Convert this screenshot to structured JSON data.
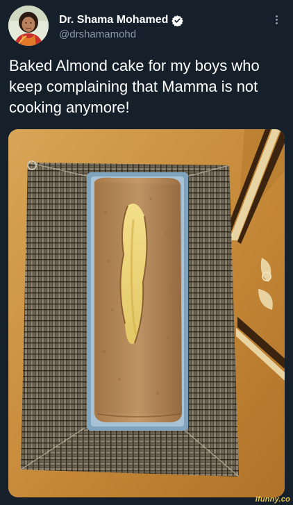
{
  "user": {
    "display_name": "Dr. Shama Mohamed",
    "handle": "@drshamamohd",
    "verified": true,
    "avatar_icon": "profile-photo"
  },
  "tweet": {
    "text": "Baked Almond cake for my boys who keep complaining that Mamma is not cooking anymore!"
  },
  "media": {
    "description_icon": "almond-cake-photo"
  },
  "watermark": {
    "text": "ifunny.co"
  },
  "colors": {
    "background": "#15202b",
    "text_primary": "#ffffff",
    "text_secondary": "#8b98a5",
    "verified_badge": "#ffffff",
    "watermark": "#e9c94a"
  }
}
